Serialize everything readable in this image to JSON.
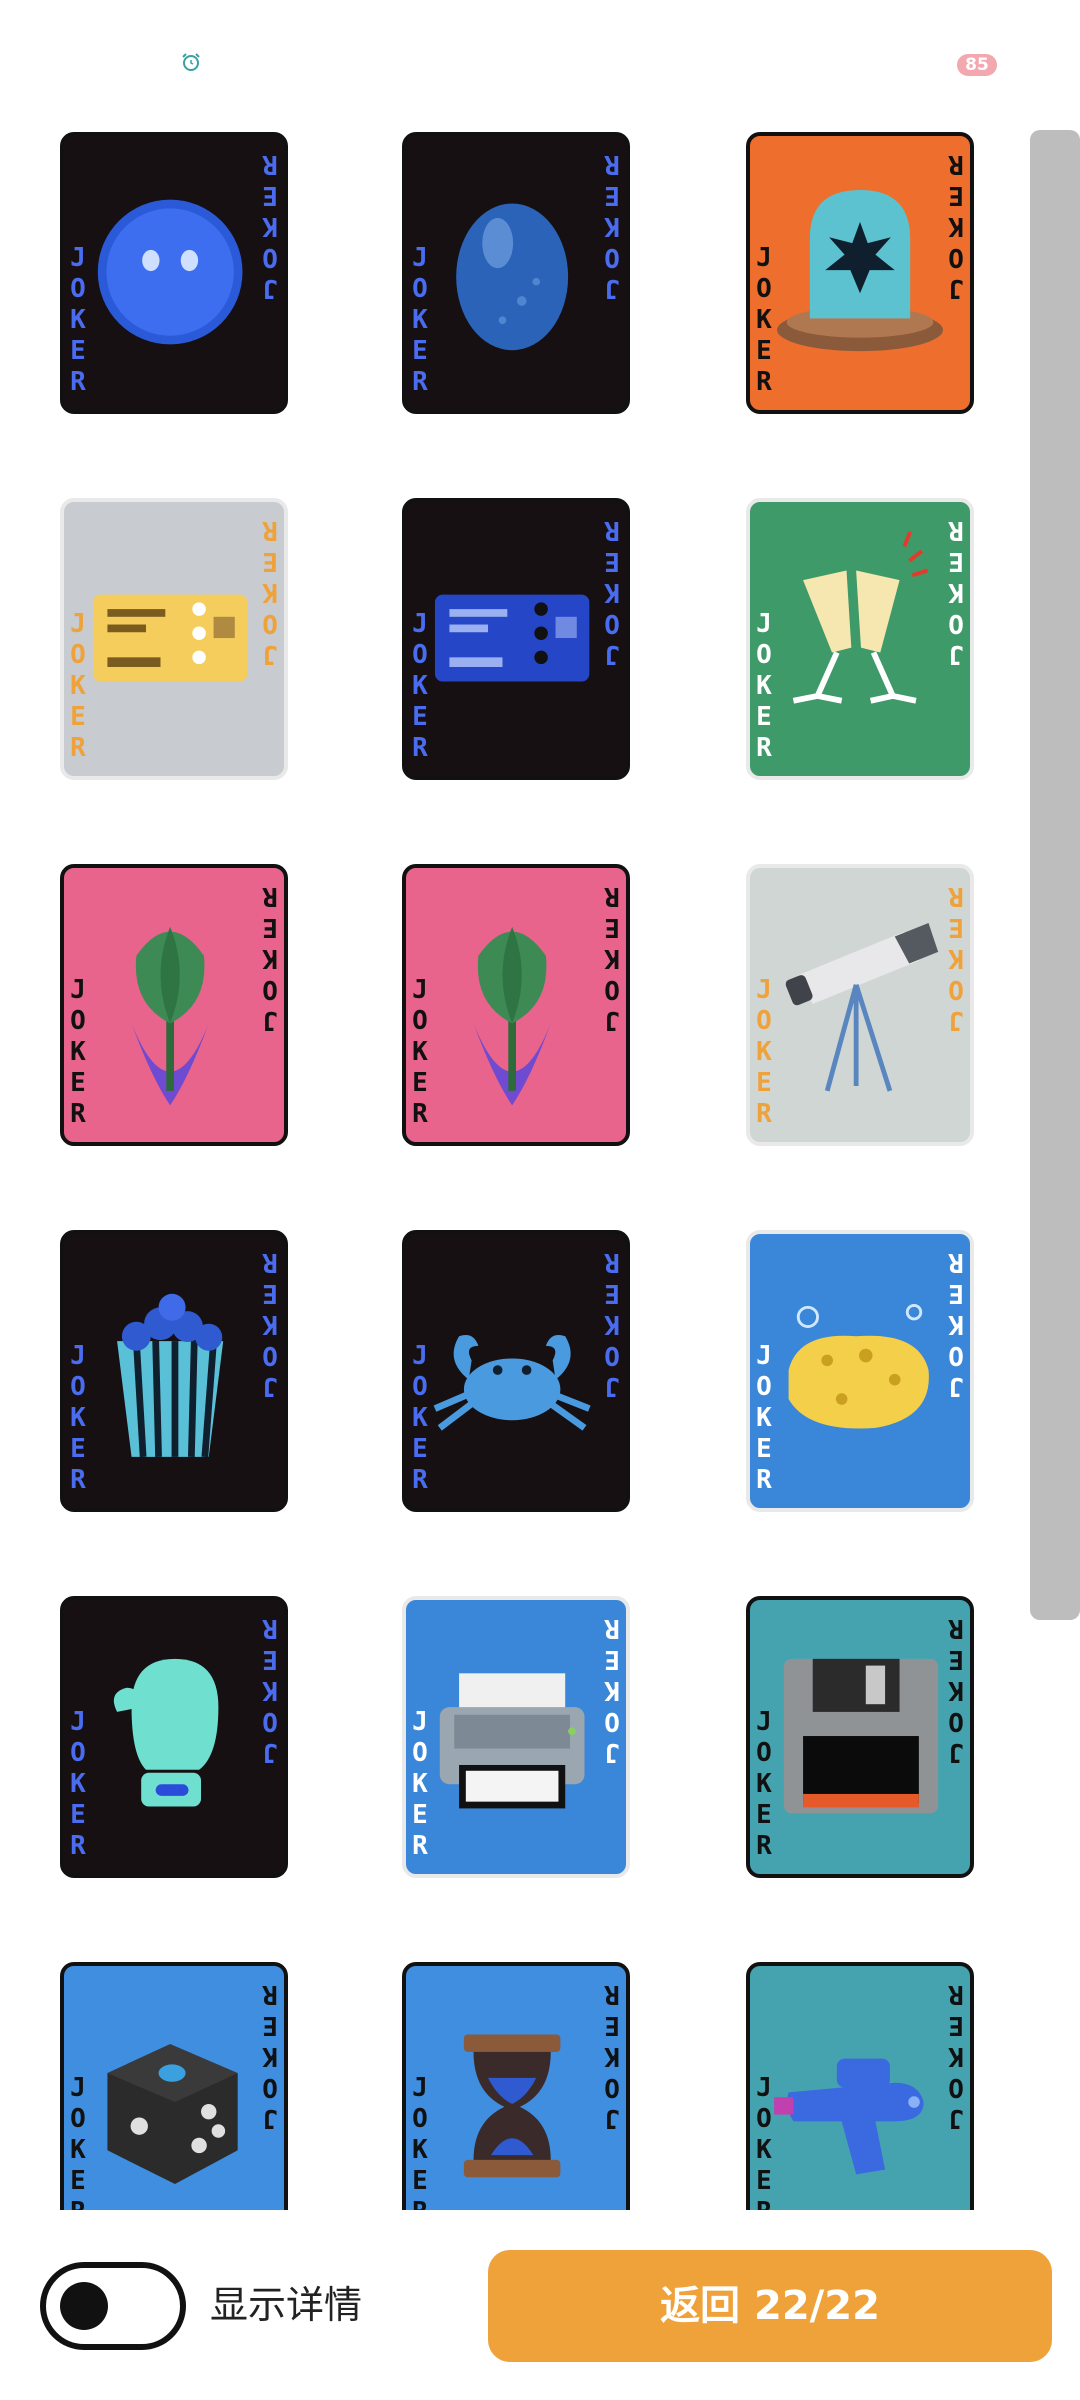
{
  "status_bar": {
    "left_icon": "alarm-clock-icon",
    "battery": "85"
  },
  "cards": [
    {
      "name": "blue-blob-card",
      "art": "blue-blob",
      "bg": "#161013",
      "text_color": "#4a6cf0",
      "label": "JOKER"
    },
    {
      "name": "blue-egg-card",
      "art": "blue-egg",
      "bg": "#161013",
      "text_color": "#4a6cf0",
      "label": "JOKER"
    },
    {
      "name": "siren-card",
      "art": "siren-light",
      "bg": "#ee6e2e",
      "text_color": "#111111",
      "label": "JOKER"
    },
    {
      "name": "gold-ticket-card",
      "art": "golden-ticket",
      "bg": "#c8cbd0",
      "text_color": "#f0a23a",
      "label": "JOKER"
    },
    {
      "name": "blue-ticket-card",
      "art": "blue-ticket",
      "bg": "#161013",
      "text_color": "#4a6cf0",
      "label": "JOKER"
    },
    {
      "name": "champagne-card",
      "art": "champagne-toast",
      "bg": "#3f9a6a",
      "text_color": "#ffffff",
      "label": "JOKER"
    },
    {
      "name": "tulip-card-1",
      "art": "tulip",
      "bg": "#e8648c",
      "text_color": "#111111",
      "label": "JOKER"
    },
    {
      "name": "tulip-card-2",
      "art": "tulip",
      "bg": "#e8648c",
      "text_color": "#111111",
      "label": "JOKER"
    },
    {
      "name": "telescope-card",
      "art": "telescope",
      "bg": "#cfd6d4",
      "text_color": "#f0a23a",
      "label": "JOKER"
    },
    {
      "name": "popcorn-card",
      "art": "popcorn",
      "bg": "#161013",
      "text_color": "#4a6cf0",
      "label": "JOKER"
    },
    {
      "name": "crab-card",
      "art": "crab",
      "bg": "#161013",
      "text_color": "#4a6cf0",
      "label": "JOKER"
    },
    {
      "name": "sponge-card",
      "art": "sponge",
      "bg": "#3a86d8",
      "text_color": "#ffffff",
      "label": "JOKER"
    },
    {
      "name": "boxing-glove-card",
      "art": "boxing-glove",
      "bg": "#161013",
      "text_color": "#4a6cf0",
      "label": "JOKER"
    },
    {
      "name": "printer-card",
      "art": "printer",
      "bg": "#3a86d8",
      "text_color": "#ffffff",
      "label": "JOKER"
    },
    {
      "name": "floppy-disk-card",
      "art": "floppy-disk",
      "bg": "#45a3b0",
      "text_color": "#111111",
      "label": "JOKER"
    },
    {
      "name": "dice-card",
      "art": "dice",
      "bg": "#3f8ee0",
      "text_color": "#111111",
      "label": "JOKER"
    },
    {
      "name": "hourglass-card",
      "art": "hourglass",
      "bg": "#3f8ee0",
      "text_color": "#111111",
      "label": "JOKER"
    },
    {
      "name": "water-gun-card",
      "art": "water-gun",
      "bg": "#45a3b0",
      "text_color": "#111111",
      "label": "JOKER"
    }
  ],
  "bottom_bar": {
    "toggle_label": "显示详情",
    "toggle_on": false,
    "return_label": "返回 22/22"
  }
}
